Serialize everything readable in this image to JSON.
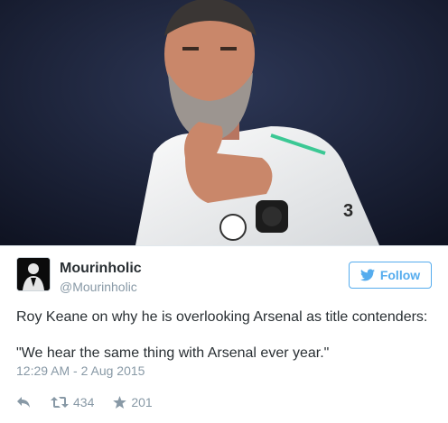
{
  "media": {
    "description_icon": "photo-image",
    "colors": {
      "background": "#171c2f",
      "shirt": "#f2f3f4",
      "skin": "#c9876a",
      "beard": "#9c9590",
      "trim": "#3bc894"
    }
  },
  "user": {
    "name": "Mourinholic",
    "handle": "@Mourinholic",
    "avatar_icon": "avatar-silhouette"
  },
  "follow_button": {
    "label": "Follow",
    "icon": "twitter-bird-icon",
    "color": "#55acee"
  },
  "tweet": {
    "line1": "Roy Keane on why he is overlooking Arsenal as title contenders:",
    "line2": "\"We hear the same thing with Arsenal ever year.\"",
    "timestamp": "12:29 AM - 2 Aug 2015"
  },
  "actions": {
    "reply_icon": "reply-icon",
    "retweet_icon": "retweet-icon",
    "retweet_count": "434",
    "favorite_icon": "star-icon",
    "favorite_count": "201"
  },
  "colors": {
    "text": "#292f33",
    "muted": "#8899a6",
    "border": "#e1e8ed"
  }
}
